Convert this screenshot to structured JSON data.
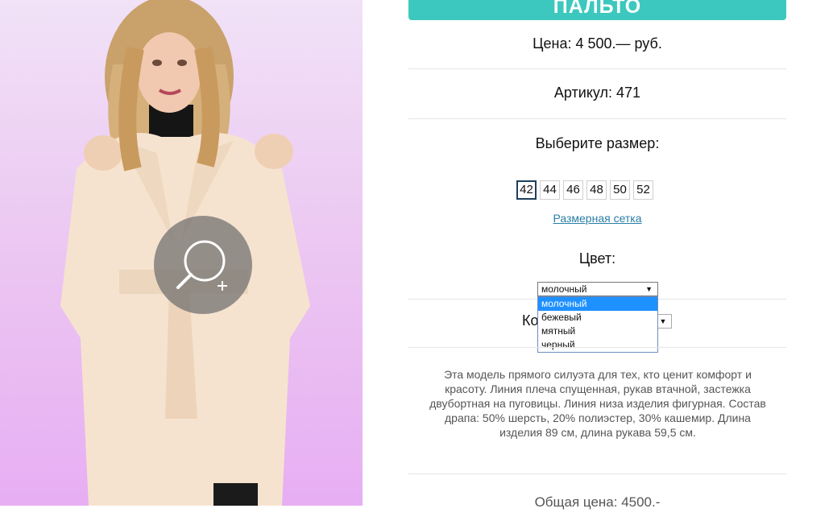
{
  "product": {
    "title": "ПАЛЬТО",
    "price": "Цена: 4 500.— руб.",
    "article": "Артикул: 471",
    "choose_size": "Выберите размер:",
    "sizes": [
      "42",
      "44",
      "46",
      "48",
      "50",
      "52"
    ],
    "selected_size": "42",
    "size_chart_link": "Размерная сетка",
    "color_label": "Цвет:",
    "color_select": {
      "value": "молочный",
      "arrow": "▼",
      "options": [
        "молочный",
        "бежевый",
        "мятный",
        "черный"
      ]
    },
    "quantity_label": "Ко",
    "quantity_arrow": "▼",
    "description": "Эта модель прямого силуэта для тех, кто ценит комфорт и красоту. Линия плеча спущенная, рукав втачной, застежка двубортная на пуговицы. Линия низа изделия фигурная. Состав драпа: 50% шерсть, 20% полиэстер, 30% кашемир. Длина изделия 89 см, длина рукава 59,5 см.",
    "total": "Общая цена: 4500.-"
  },
  "colors": {
    "accent": "#3cc8bf",
    "link": "#2a7fa8",
    "dropdown_highlight": "#1e90ff"
  },
  "icons": {
    "zoom": "magnifier-plus-icon"
  }
}
